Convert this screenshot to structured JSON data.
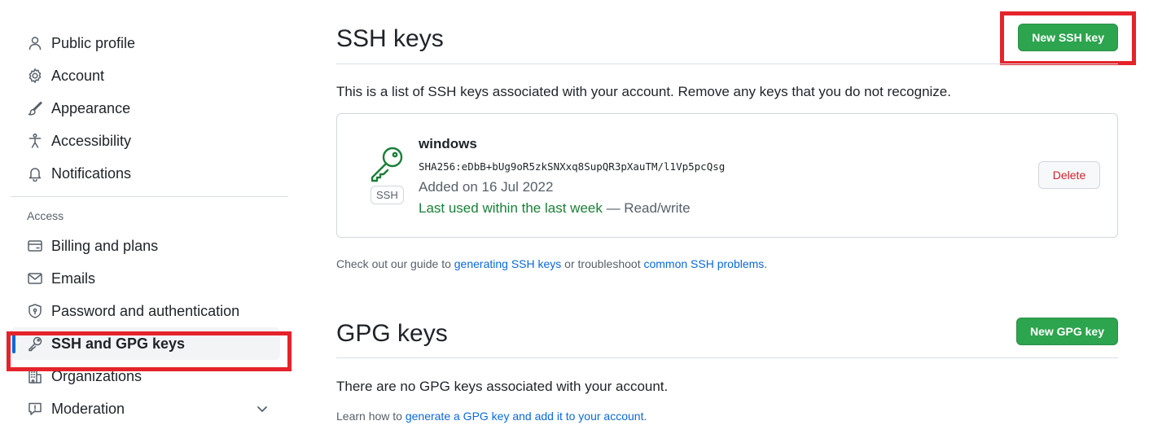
{
  "sidebar": {
    "items_top": [
      {
        "label": "Public profile",
        "icon": "person-icon"
      },
      {
        "label": "Account",
        "icon": "gear-icon"
      },
      {
        "label": "Appearance",
        "icon": "paintbrush-icon"
      },
      {
        "label": "Accessibility",
        "icon": "accessibility-icon"
      },
      {
        "label": "Notifications",
        "icon": "bell-icon"
      }
    ],
    "group_label": "Access",
    "items_access": [
      {
        "label": "Billing and plans",
        "icon": "credit-card-icon"
      },
      {
        "label": "Emails",
        "icon": "mail-icon"
      },
      {
        "label": "Password and authentication",
        "icon": "shield-lock-icon"
      },
      {
        "label": "SSH and GPG keys",
        "icon": "key-icon",
        "active": true
      },
      {
        "label": "Organizations",
        "icon": "organization-icon"
      },
      {
        "label": "Moderation",
        "icon": "report-icon",
        "expandable": true
      }
    ]
  },
  "ssh": {
    "title": "SSH keys",
    "new_button": "New SSH key",
    "description": "This is a list of SSH keys associated with your account. Remove any keys that you do not recognize.",
    "key": {
      "name": "windows",
      "fingerprint": "SHA256:eDbB+bUg9oR5zkSNXxq8SupQR3pXauTM/l1Vp5pcQsg",
      "added": "Added on 16 Jul 2022",
      "last_used": "Last used within the last week",
      "access": " — Read/write",
      "badge": "SSH",
      "delete_button": "Delete"
    },
    "guide_prefix": "Check out our guide to ",
    "guide_link1": "generating SSH keys",
    "guide_middle": " or troubleshoot ",
    "guide_link2": "common SSH problems",
    "guide_suffix": "."
  },
  "gpg": {
    "title": "GPG keys",
    "new_button": "New GPG key",
    "empty_text": "There are no GPG keys associated with your account.",
    "learn_prefix": "Learn how to ",
    "learn_link": "generate a GPG key and add it to your account",
    "learn_suffix": "."
  },
  "colors": {
    "primary_green": "#2da44e",
    "link_blue": "#0969da",
    "danger_red": "#cf222e",
    "highlight_red": "#e5232a",
    "active_bar": "#0969da"
  }
}
